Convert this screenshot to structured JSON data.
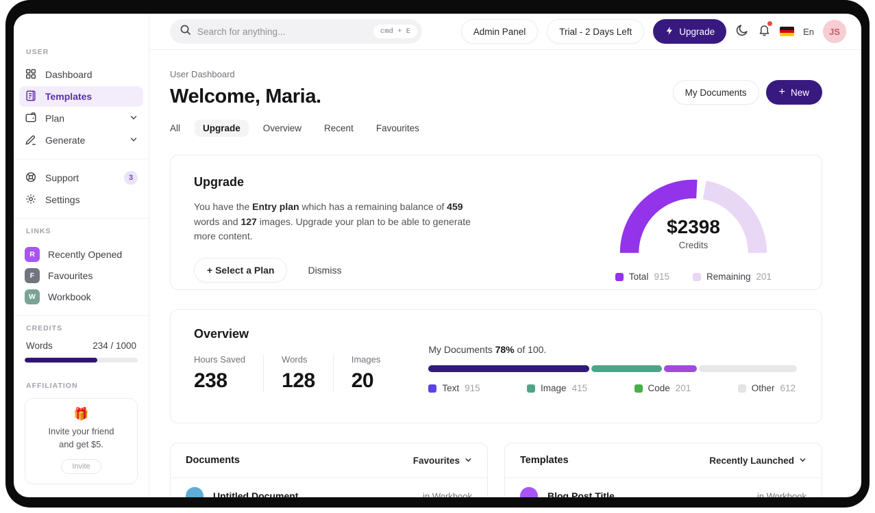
{
  "colors": {
    "accent_dark": "#38197f",
    "purple": "#9333ea",
    "lavender": "#e9d7f6",
    "active_nav_bg": "#f3edfb",
    "active_nav_text": "#5b2da8"
  },
  "sidebar": {
    "section_user": "USER",
    "section_links": "LINKS",
    "section_credits": "CREDITS",
    "section_affiliation": "AFFILIATION",
    "nav": [
      {
        "label": "Dashboard"
      },
      {
        "label": "Templates",
        "active": true
      },
      {
        "label": "Plan",
        "expandable": true
      },
      {
        "label": "Generate",
        "expandable": true
      }
    ],
    "support": {
      "label": "Support",
      "badge": "3"
    },
    "settings": {
      "label": "Settings"
    },
    "links": [
      {
        "initial": "R",
        "label": "Recently Opened",
        "color": "#a855f7"
      },
      {
        "initial": "F",
        "label": "Favourites",
        "color": "#71757e"
      },
      {
        "initial": "W",
        "label": "Workbook",
        "color": "#7aa396"
      }
    ],
    "credits": {
      "label": "Words",
      "value": "234 / 1000",
      "fill_percent": 64,
      "fill_color": "#2f1670"
    },
    "affiliation": {
      "emoji": "🎁",
      "line1": "Invite your friend",
      "line2": "and get $5.",
      "button": "Invite"
    }
  },
  "topbar": {
    "search_placeholder": "Search for anything...",
    "shortcut": "cmd + E",
    "admin_panel": "Admin Panel",
    "trial": "Trial - 2 Days Left",
    "upgrade": "Upgrade",
    "lang": "En",
    "avatar_initials": "JS"
  },
  "header": {
    "breadcrumb": "User Dashboard",
    "title": "Welcome, Maria.",
    "my_documents": "My Documents",
    "new_plus": "+",
    "new_button": "New",
    "tabs": [
      {
        "label": "All"
      },
      {
        "label": "Upgrade",
        "active": true
      },
      {
        "label": "Overview"
      },
      {
        "label": "Recent"
      },
      {
        "label": "Favourites"
      }
    ]
  },
  "upgrade_card": {
    "title": "Upgrade",
    "body": [
      {
        "t": "You have the "
      },
      {
        "t": "Entry plan",
        "b": 1
      },
      {
        "t": " which has a remaining balance of "
      },
      {
        "t": "459",
        "b": 1
      },
      {
        "t": " words and "
      },
      {
        "t": "127",
        "b": 1
      },
      {
        "t": " images. Upgrade your plan to be able to generate more content."
      }
    ],
    "select_plan": "+ Select a Plan",
    "dismiss": "Dismiss",
    "gauge": {
      "center_value": "$2398",
      "center_label": "Credits",
      "legend": [
        {
          "label": "Total",
          "value": "915",
          "color": "#9333ea"
        },
        {
          "label": "Remaining",
          "value": "201",
          "color": "#e9d7f6"
        }
      ]
    }
  },
  "overview_card": {
    "title": "Overview",
    "stats": [
      {
        "label": "Hours Saved",
        "value": "238"
      },
      {
        "label": "Words",
        "value": "128"
      },
      {
        "label": "Images",
        "value": "20"
      }
    ],
    "progress": {
      "prefix": "My Documents ",
      "percent": "78%",
      "suffix": " of 100.",
      "segments": [
        {
          "percent": 43.5,
          "color": "#321b7a"
        },
        {
          "percent": 19,
          "color": "#4da489"
        },
        {
          "percent": 9,
          "color": "#a24bdb"
        },
        {
          "percent": 26.5,
          "color": "#e7e7ea"
        }
      ],
      "legend": [
        {
          "label": "Text",
          "value": "915",
          "color": "#5b43e4"
        },
        {
          "label": "Image",
          "value": "415",
          "color": "#4da489"
        },
        {
          "label": "Code",
          "value": "201",
          "color": "#46b04a"
        },
        {
          "label": "Other",
          "value": "612",
          "color": "#e4e4e7"
        }
      ]
    }
  },
  "documents_card": {
    "title": "Documents",
    "filter": "Favourites",
    "row": {
      "title": "Untitled Document",
      "meta": "in Workbook",
      "color": "#5fadd6"
    }
  },
  "templates_card": {
    "title": "Templates",
    "filter": "Recently Launched",
    "row": {
      "title": "Blog Post Title",
      "meta": "in Workbook",
      "color": "#a855f7"
    }
  },
  "chart_data": [
    {
      "type": "pie",
      "variant": "half-donut-gauge",
      "title": "Credits",
      "center_value": "$2398",
      "center_label": "Credits",
      "series": [
        {
          "name": "Total",
          "value": 915,
          "color": "#9333ea"
        },
        {
          "name": "Remaining",
          "value": 201,
          "color": "#e9d7f6"
        }
      ],
      "visual_sweep_degrees": {
        "Total": 93,
        "Remaining": 80,
        "gap": 7,
        "total_arc": 180
      },
      "legend_position": "bottom"
    },
    {
      "type": "bar",
      "variant": "stacked-horizontal-progress",
      "title": "My Documents 78% of 100.",
      "series": [
        {
          "name": "Text",
          "value": 915,
          "color": "#5b43e4"
        },
        {
          "name": "Image",
          "value": 415,
          "color": "#4da489"
        },
        {
          "name": "Code",
          "value": 201,
          "color": "#46b04a"
        },
        {
          "name": "Other",
          "value": 612,
          "color": "#e4e4e7"
        }
      ],
      "visual_width_percent": {
        "Text": 43.5,
        "Image": 19,
        "Code": 9,
        "Other": 26.5
      },
      "completion": "78% of 100"
    },
    {
      "type": "bar",
      "variant": "single-progress",
      "title": "Words credits",
      "value": 234,
      "max": 1000,
      "label": "234 / 1000",
      "visual_fill_percent": 64
    }
  ]
}
